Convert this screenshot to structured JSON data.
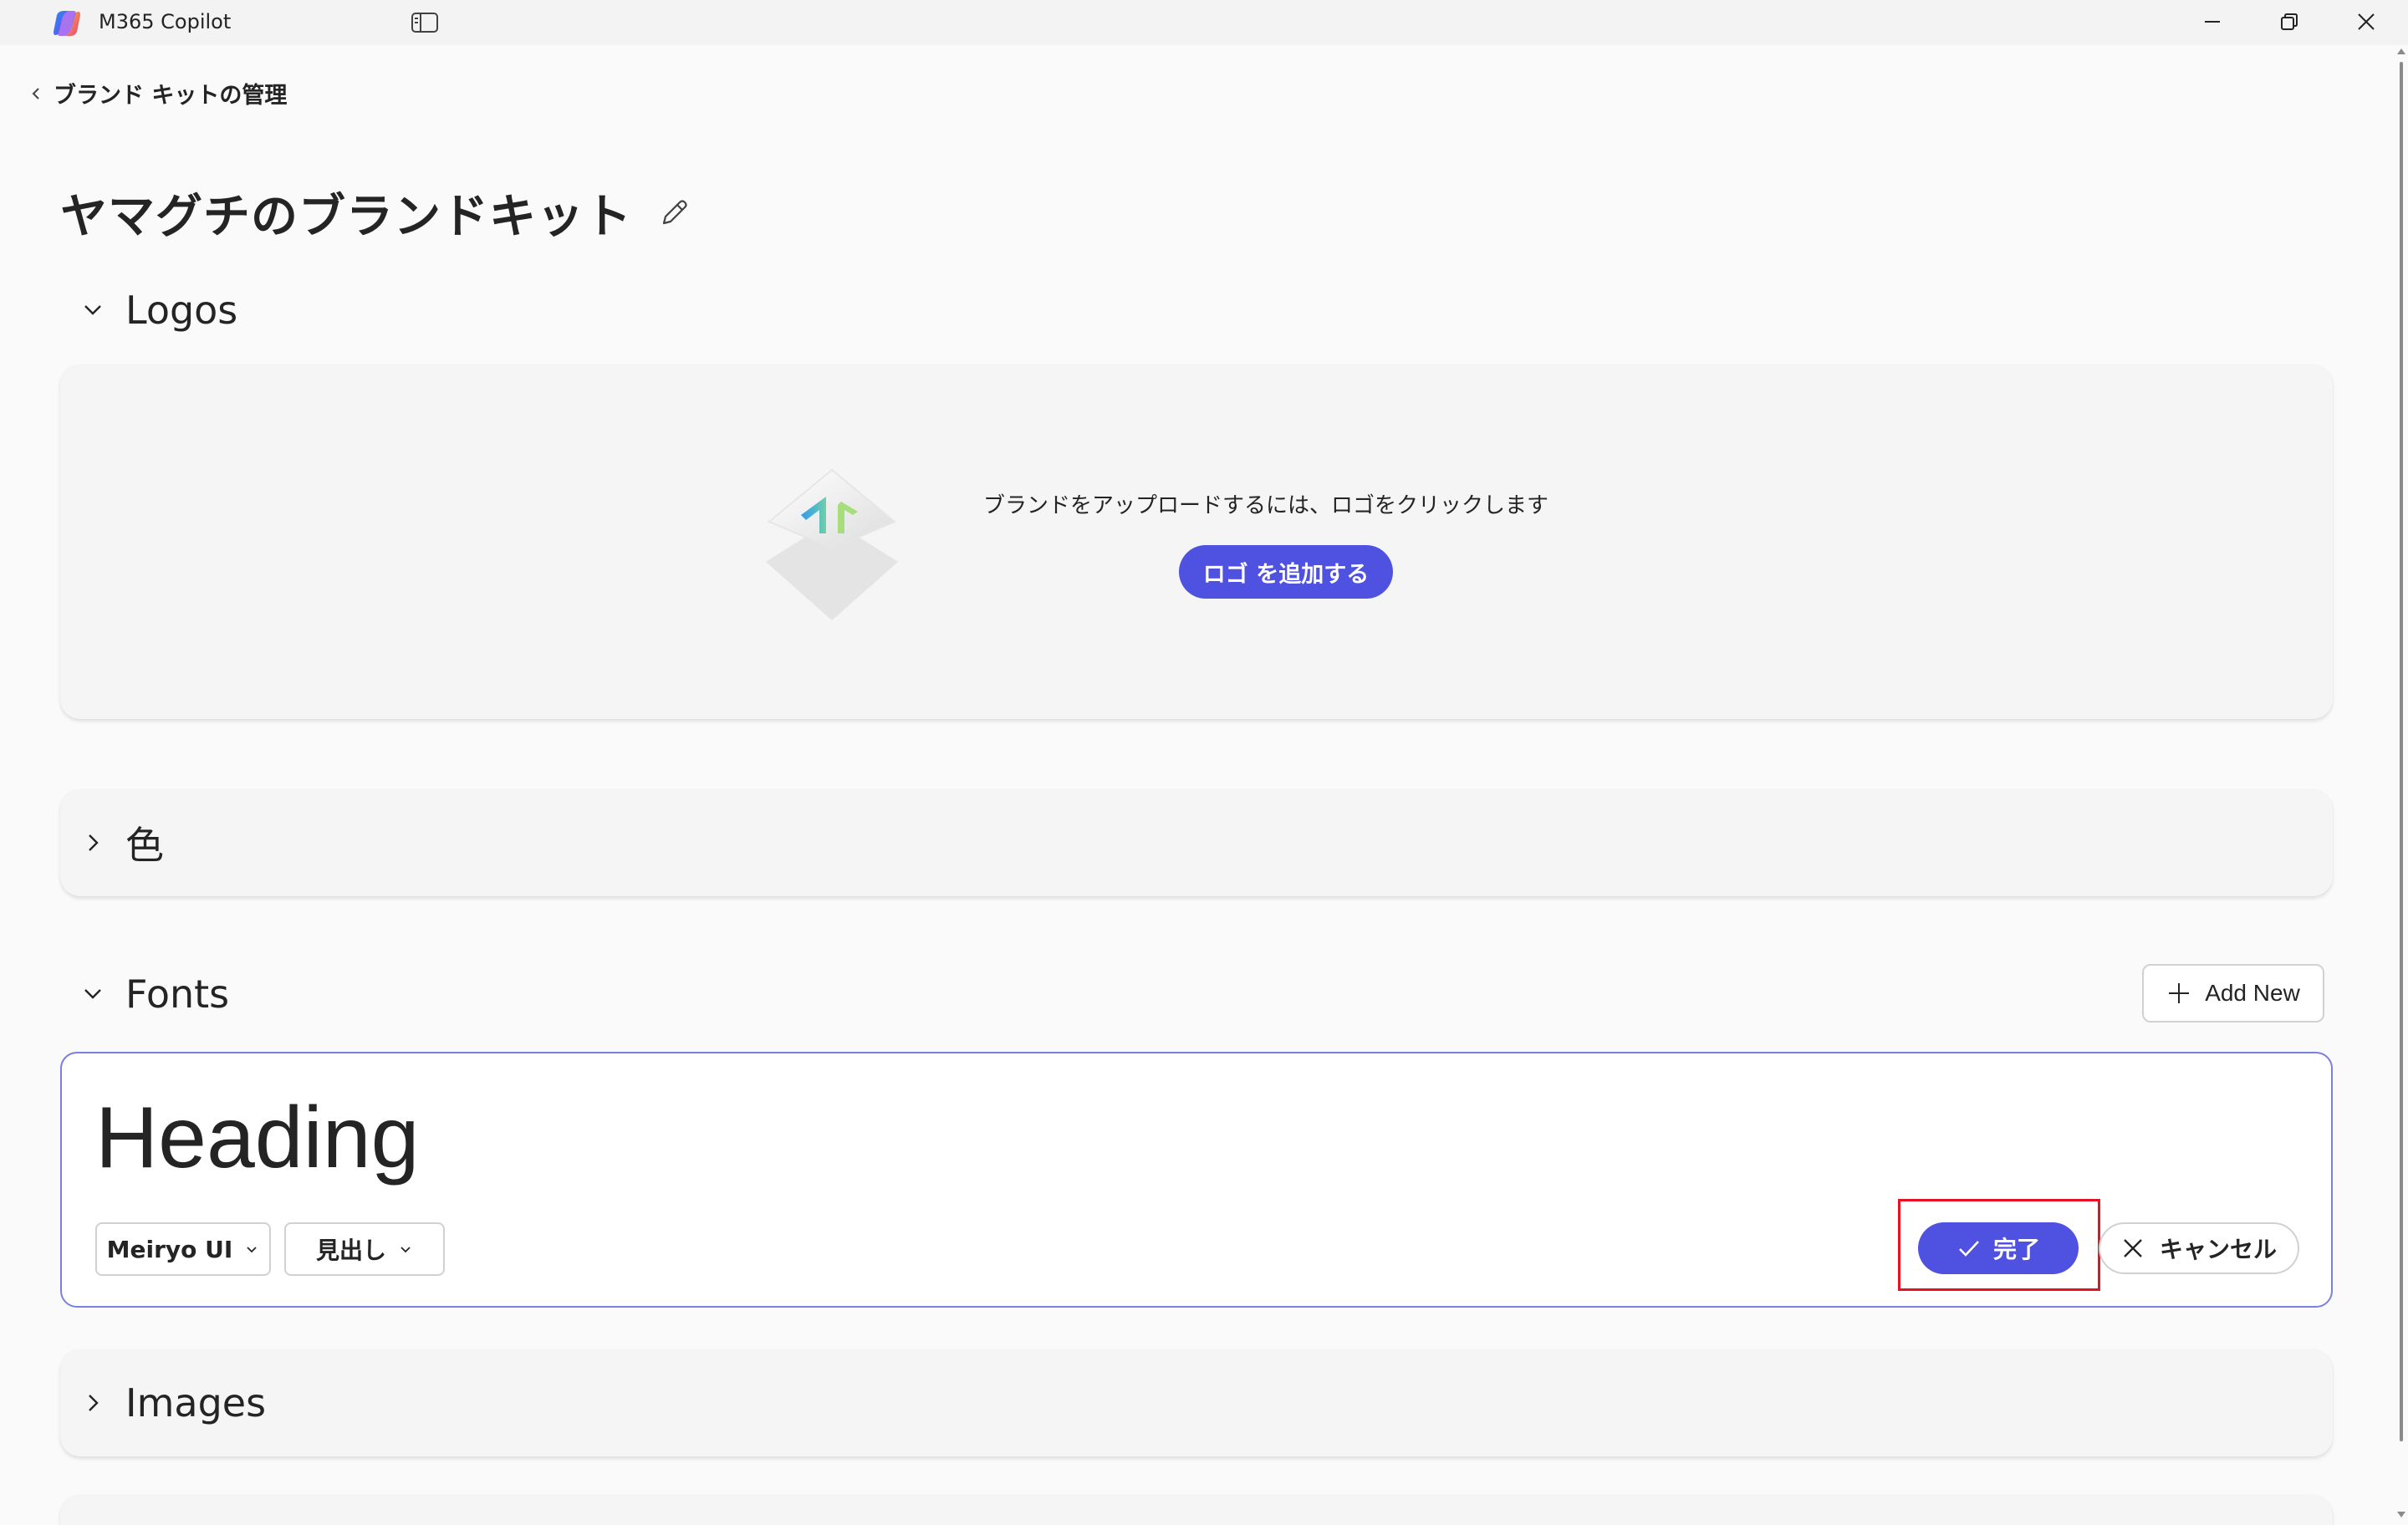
{
  "app": {
    "title": "M365 Copilot"
  },
  "nav": {
    "back_label": "ブランド キットの管理"
  },
  "page": {
    "title": "ヤマグチのブランドキット"
  },
  "logos": {
    "label": "Logos",
    "expanded": true,
    "hint": "ブランドをアップロードするには、ロゴをクリックします",
    "add_button": "ロゴ を追加する"
  },
  "colors": {
    "label": "色",
    "expanded": false
  },
  "fonts": {
    "label": "Fonts",
    "expanded": true,
    "add_new_label": "Add New",
    "preview_text": "Heading",
    "font_family_value": "Meiryo UI",
    "style_value": "見出し",
    "done_label": "完了",
    "cancel_label": "キャンセル"
  },
  "images": {
    "label": "Images",
    "expanded": false
  },
  "theme": {
    "accent": "#4f52e0",
    "highlight": "#e81123"
  }
}
